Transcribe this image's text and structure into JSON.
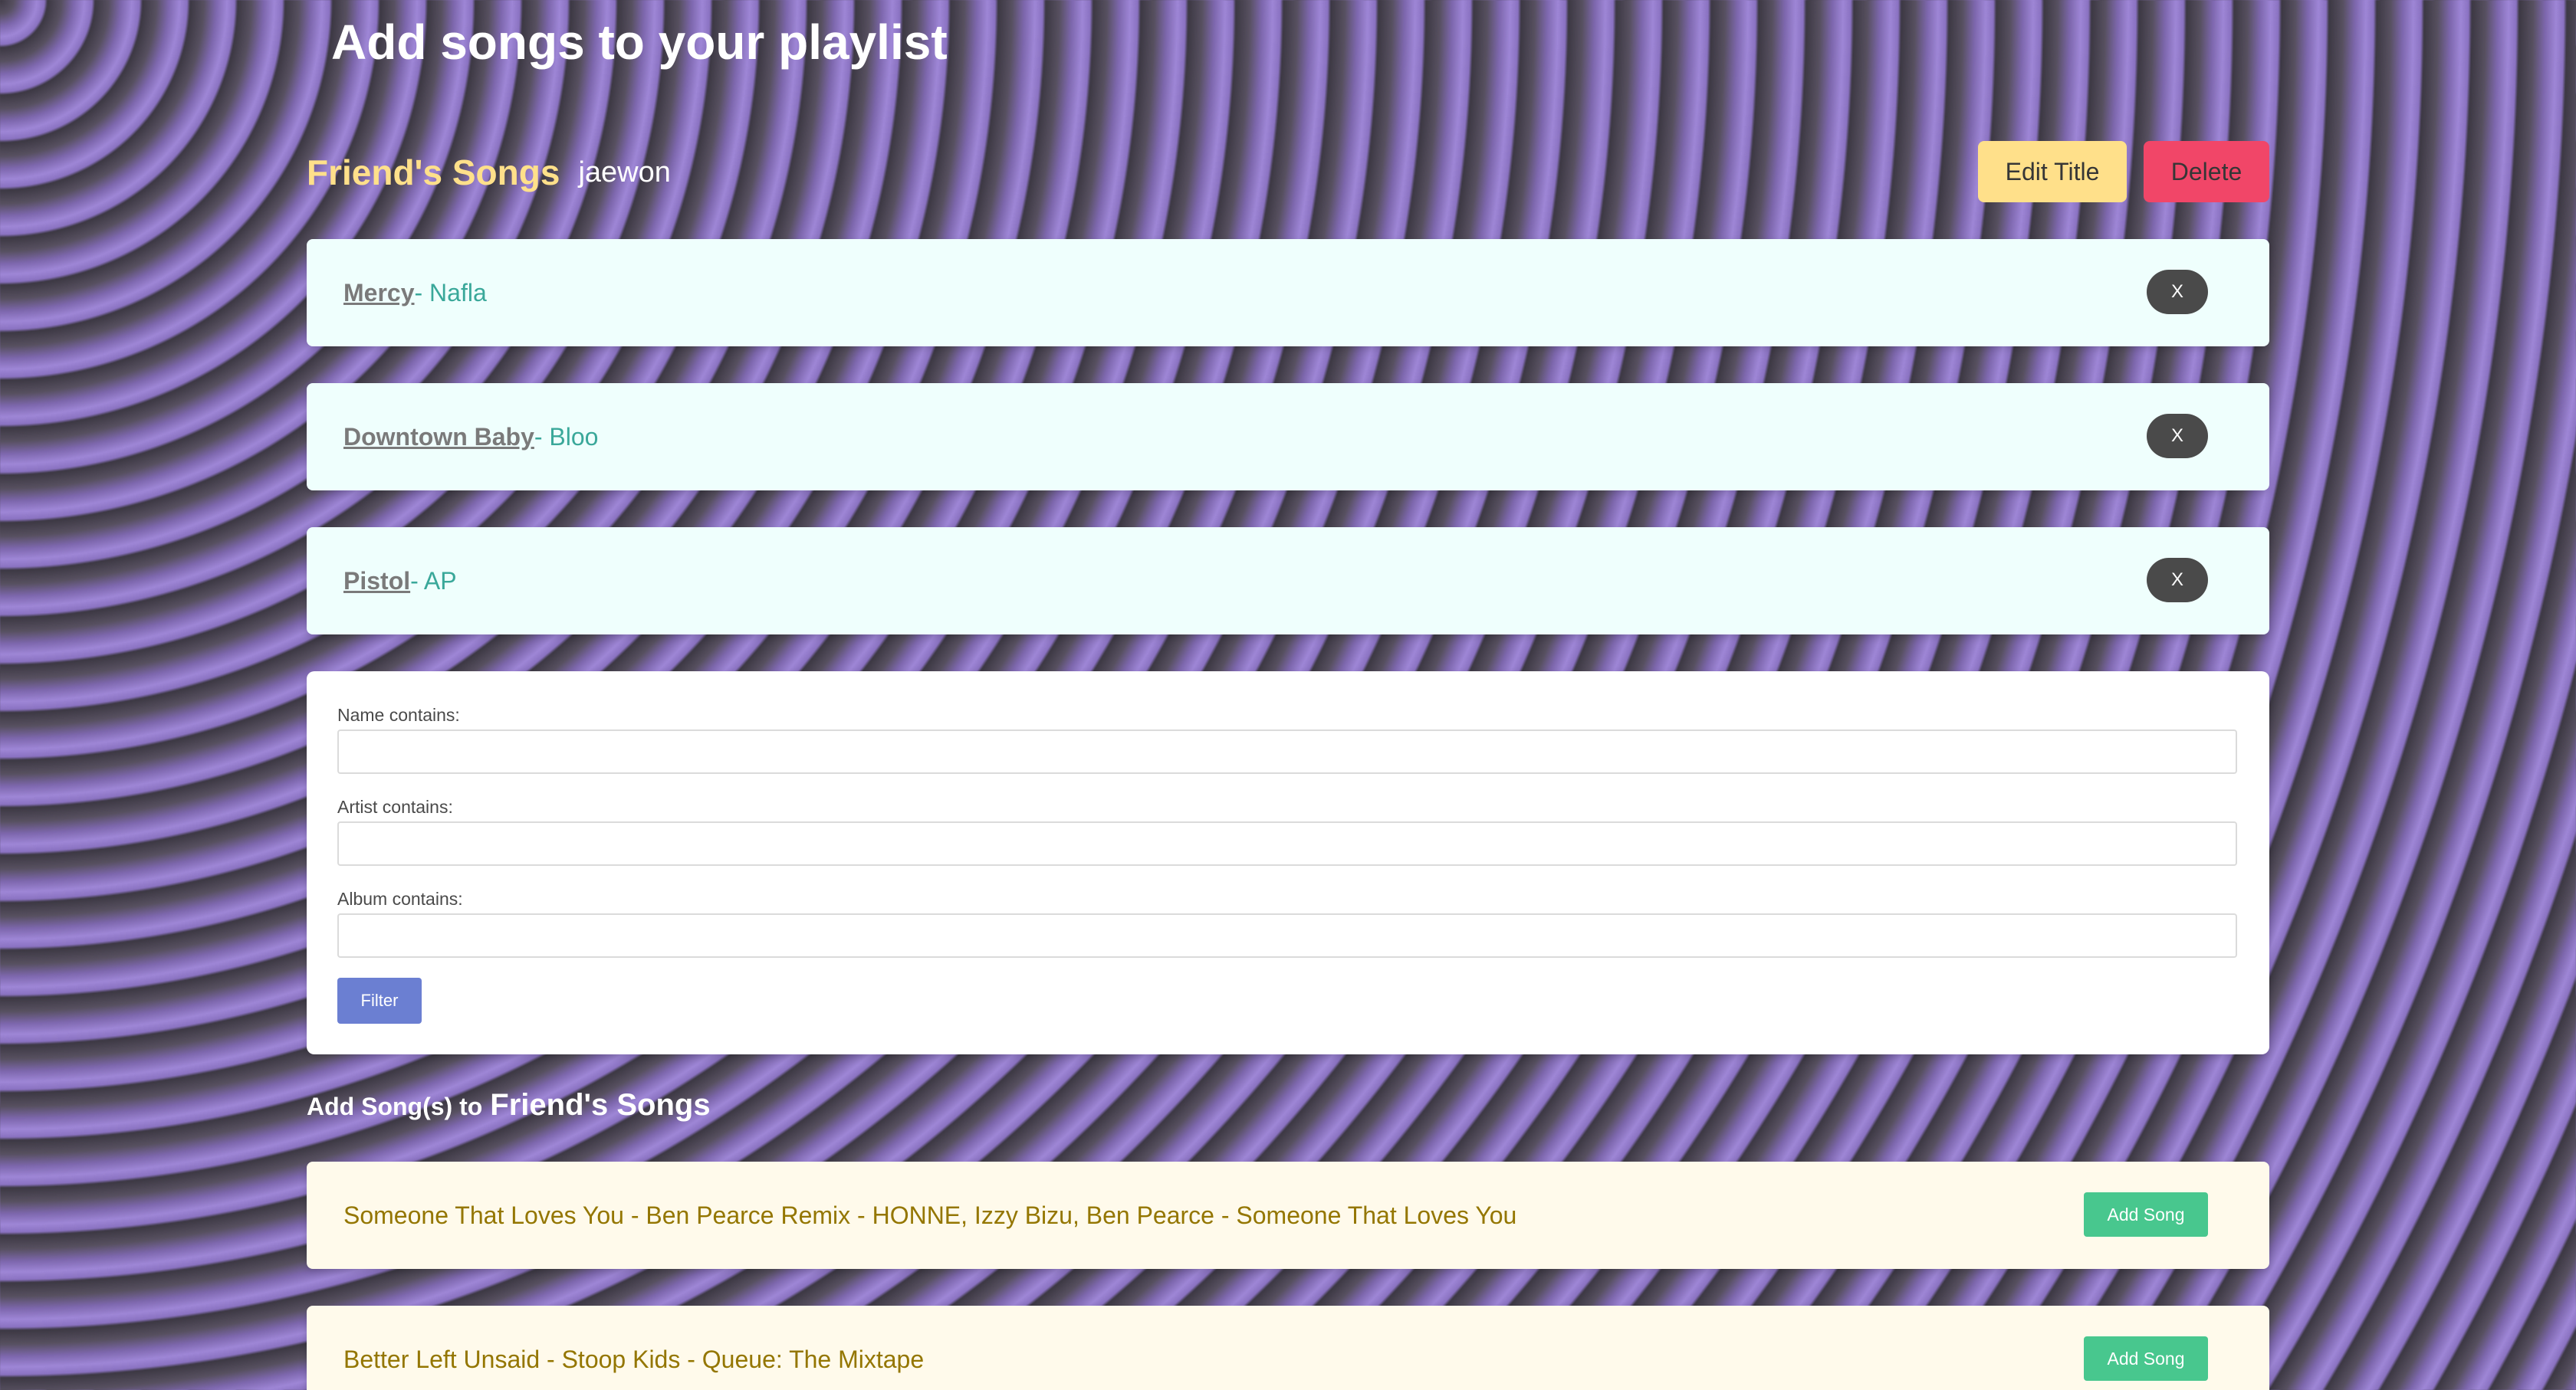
{
  "page": {
    "title": "Add songs to your playlist"
  },
  "playlist": {
    "title": "Friend's Songs",
    "owner": "jaewon",
    "edit_label": "Edit Title",
    "delete_label": "Delete",
    "songs": [
      {
        "name": "Mercy",
        "artist": "- Nafla",
        "remove_label": "X"
      },
      {
        "name": "Downtown Baby",
        "artist": "- Bloo",
        "remove_label": "X"
      },
      {
        "name": "Pistol",
        "artist": "- AP",
        "remove_label": "X"
      }
    ]
  },
  "filter": {
    "name_label": "Name contains:",
    "name_value": "",
    "artist_label": "Artist contains:",
    "artist_value": "",
    "album_label": "Album contains:",
    "album_value": "",
    "button_label": "Filter"
  },
  "add_section": {
    "heading_prefix": "Add Song(s) to",
    "heading_playlist": "Friend's Songs",
    "results": [
      {
        "text": "Someone That Loves You - Ben Pearce Remix - HONNE, Izzy Bizu, Ben Pearce - Someone That Loves You",
        "button_label": "Add Song"
      },
      {
        "text": "Better Left Unsaid - Stoop Kids - Queue: The Mixtape",
        "button_label": "Add Song"
      }
    ]
  },
  "colors": {
    "accent_yellow": "#ffe08a",
    "danger": "#f14668",
    "primary_link": "#6b7fd2",
    "success": "#48c78e"
  }
}
